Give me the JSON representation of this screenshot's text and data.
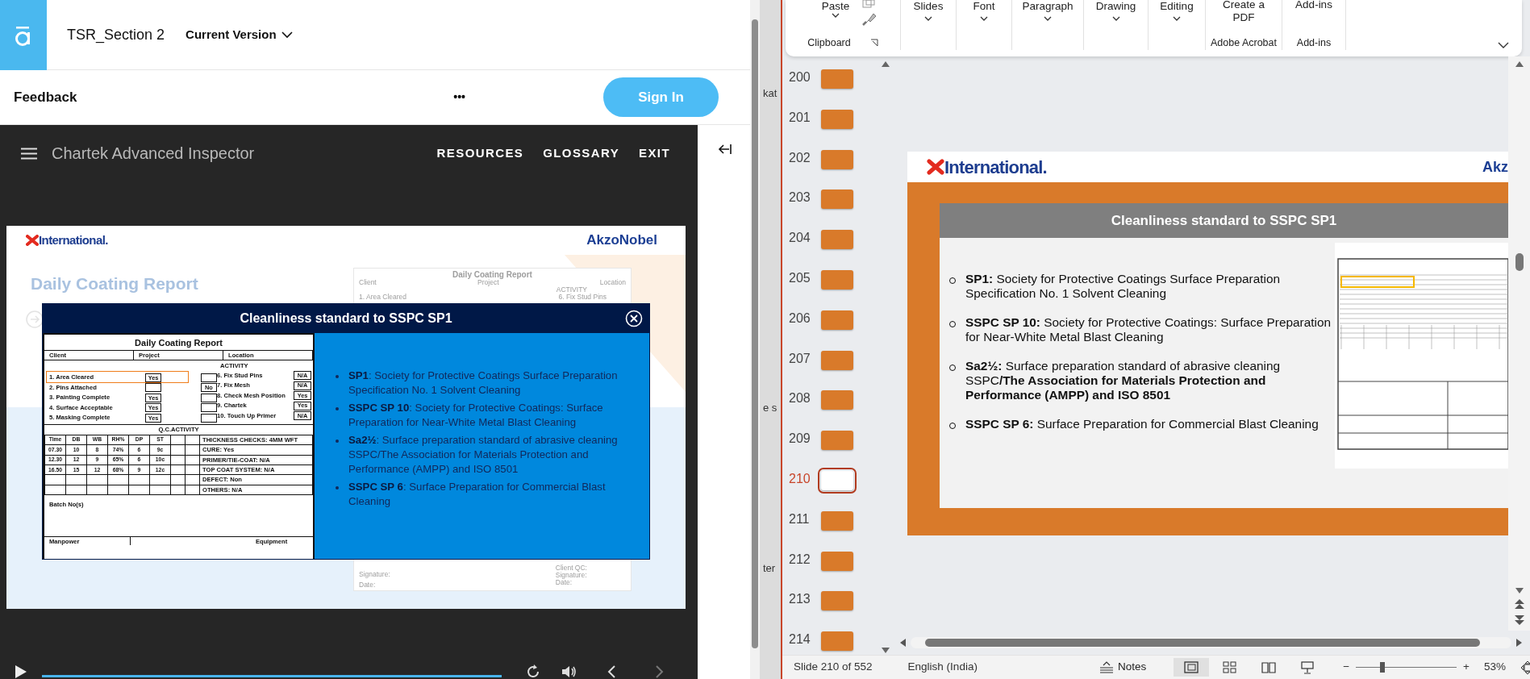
{
  "browser": {
    "app_title": "TSR_Section 2",
    "version_menu": "Current Version",
    "feedback": "Feedback",
    "more": "•••",
    "sign_in": "Sign In"
  },
  "course": {
    "title": "Chartek Advanced Inspector",
    "nav": [
      "RESOURCES",
      "GLOSSARY",
      "EXIT"
    ]
  },
  "slide": {
    "brand_left": "International.",
    "brand_right": "AkzoNobel",
    "heading": "Daily Coating Report",
    "faded_form": {
      "title": "Daily Coating Report",
      "top": [
        "Client",
        "Project",
        "Location"
      ],
      "activity": "ACTIVITY",
      "item_left": "1. Area Cleared",
      "item_right": "6. Fix Stud Pins",
      "bottom_left": [
        "Signature:",
        "Date:"
      ],
      "bottom_right": [
        "Client QC:",
        "Signature:",
        "Date:"
      ]
    }
  },
  "modal": {
    "title": "Cleanliness standard to SSPC SP1",
    "form": {
      "title": "Daily Coating Report",
      "header": [
        "Client",
        "Project",
        "Location"
      ],
      "activity_title": "ACTIVITY",
      "left_items": [
        {
          "label": "1. Area Cleared",
          "yes": "Yes",
          "highlighted": true
        },
        {
          "label": "2. Pins Attached",
          "no": "No",
          "highlighted": false
        },
        {
          "label": "3. Painting Complete",
          "yes": "Yes",
          "highlighted": false
        },
        {
          "label": "4. Surface Acceptable",
          "yes": "Yes",
          "highlighted": false
        },
        {
          "label": "5. Masking Complete",
          "yes": "Yes",
          "highlighted": false
        }
      ],
      "right_items": [
        {
          "label": "6. Fix Stud Pins",
          "value": "N/A"
        },
        {
          "label": "7. Fix Mesh",
          "value": "N/A"
        },
        {
          "label": "8. Check Mesh Position",
          "value": "Yes"
        },
        {
          "label": "9. Chartek",
          "value": "Yes"
        },
        {
          "label": "10. Touch Up Primer",
          "value": "N/A"
        }
      ],
      "qc_title": "Q.C.ACTIVITY",
      "qc_columns": [
        "Time",
        "DB",
        "WB",
        "RH%",
        "DP",
        "ST"
      ],
      "qc_rows": [
        [
          "07.30",
          "10",
          "8",
          "74%",
          "6",
          "9c"
        ],
        [
          "12.30",
          "12",
          "9",
          "65%",
          "6",
          "10c"
        ],
        [
          "16.50",
          "15",
          "12",
          "68%",
          "9",
          "12c"
        ]
      ],
      "checks": [
        {
          "label": "THICKNESS CHECKS:",
          "value": "4MM WFT"
        },
        {
          "label": "CURE:",
          "value": "Yes"
        },
        {
          "label": "PRIMER/TIE-COAT:",
          "value": "N/A"
        },
        {
          "label": "TOP COAT SYSTEM:",
          "value": "N/A"
        },
        {
          "label": "DEFECT:",
          "value": "Non"
        },
        {
          "label": "OTHERS:",
          "value": "N/A"
        }
      ],
      "batch": "Batch No(s)",
      "footer": [
        "Manpower",
        "Equipment"
      ]
    },
    "bullets": [
      "**SP1**: Society for Protective Coatings Surface Preparation Specification No. 1 Solvent Cleaning",
      "**SSPC SP 10**: Society for Protective Coatings: Surface Preparation for Near-White Metal Blast Cleaning",
      "**Sa2½**: Surface preparation standard of abrasive cleaning SSPC/The Association for Materials Protection and Performance (AMPP) and ISO 8501",
      "**SSPC SP 6**: Surface Preparation for Commercial Blast Cleaning"
    ]
  },
  "player": {
    "level": 1
  },
  "behind_window": [
    "kat",
    "e s",
    "ter"
  ],
  "powerpoint": {
    "ribbon": [
      {
        "kind": "clipboard",
        "command": "Paste",
        "group": "Clipboard"
      },
      {
        "kind": "menu",
        "command": "Slides"
      },
      {
        "kind": "menu",
        "command": "Font"
      },
      {
        "kind": "menu",
        "command": "Paragraph"
      },
      {
        "kind": "menu",
        "command": "Drawing"
      },
      {
        "kind": "menu",
        "command": "Editing"
      },
      {
        "kind": "large",
        "command": "Create a PDF",
        "group": "Adobe Acrobat"
      },
      {
        "kind": "large",
        "command": "Add-ins",
        "group": "Add-ins"
      }
    ],
    "thumbnails": [
      {
        "number": "200",
        "selected": false
      },
      {
        "number": "201",
        "selected": false
      },
      {
        "number": "202",
        "selected": false
      },
      {
        "number": "203",
        "selected": false
      },
      {
        "number": "204",
        "selected": false
      },
      {
        "number": "205",
        "selected": false
      },
      {
        "number": "206",
        "selected": false
      },
      {
        "number": "207",
        "selected": false
      },
      {
        "number": "208",
        "selected": false
      },
      {
        "number": "209",
        "selected": false
      },
      {
        "number": "210",
        "selected": true
      },
      {
        "number": "211",
        "selected": false
      },
      {
        "number": "212",
        "selected": false
      },
      {
        "number": "213",
        "selected": false
      },
      {
        "number": "214",
        "selected": false
      }
    ],
    "slide": {
      "brand_left": "International.",
      "brand_right": "Akz",
      "title": "Cleanliness standard to SSPC SP1",
      "bullets": [
        "**SP1:** Society for Protective Coatings Surface Preparation Specification No. 1 Solvent Cleaning",
        "**SSPC SP 10:** Society for Protective Coatings: Surface Preparation for Near-White Metal Blast Cleaning",
        "**Sa2½:** Surface preparation standard of abrasive cleaning SSPC**/The Association for Materials Protection and Performance (AMPP) and ISO 8501**",
        "**SSPC SP 6:** Surface Preparation for Commercial Blast Cleaning"
      ]
    },
    "status": {
      "slide": "Slide 210 of 552",
      "language": "English (India)",
      "notes": "Notes",
      "zoom_out": "−",
      "zoom_in": "+",
      "zoom": "53%",
      "zoom_level": {
        "level": 0.25
      }
    }
  }
}
